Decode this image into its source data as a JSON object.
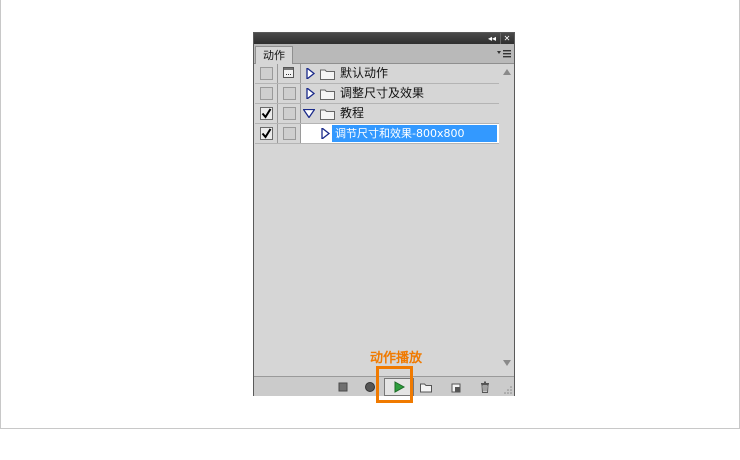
{
  "panel": {
    "titlebar": {
      "collapse_glyph": "◂◂",
      "close_glyph": "✕"
    },
    "tab_label": "动作",
    "menu_icon": "panel-menu-icon"
  },
  "actions": {
    "rows": [
      {
        "label": "默认动作",
        "checked": false,
        "dialog": true,
        "expanded": false,
        "kind": "set"
      },
      {
        "label": "调整尺寸及效果",
        "checked": false,
        "dialog": false,
        "expanded": false,
        "kind": "set"
      },
      {
        "label": "教程",
        "checked": true,
        "dialog": false,
        "expanded": true,
        "kind": "set"
      },
      {
        "label": "调节尺寸和效果-800x800",
        "checked": true,
        "dialog": false,
        "expanded": false,
        "kind": "action",
        "selected": true
      }
    ]
  },
  "toolbar": {
    "buttons": [
      "stop-icon",
      "record-icon",
      "play-icon",
      "new-set-icon",
      "new-action-icon",
      "trash-icon"
    ]
  },
  "callout": {
    "label": "动作播放",
    "color": "#f07a00"
  },
  "colors": {
    "selection": "#3399ff",
    "panel_bg": "#d6d6d6",
    "play_green": "#2e9e3e"
  }
}
